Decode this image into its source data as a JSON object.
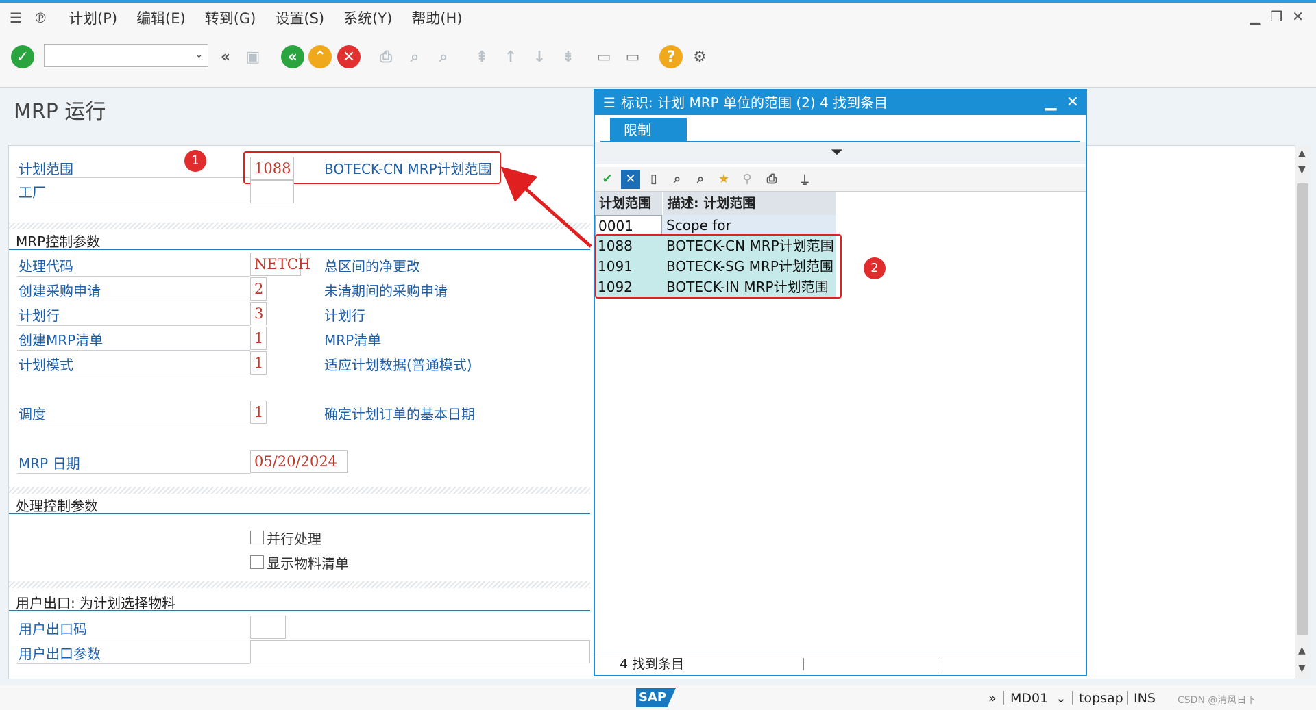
{
  "menubar": {
    "items": [
      "计划(P)",
      "编辑(E)",
      "转到(G)",
      "设置(S)",
      "系统(Y)",
      "帮助(H)"
    ]
  },
  "page": {
    "title": "MRP 运行"
  },
  "form": {
    "planning_scope": {
      "label": "计划范围",
      "value": "1088",
      "desc": "BOTECK-CN MRP计划范围"
    },
    "plant": {
      "label": "工厂",
      "value": ""
    },
    "mrp_control": {
      "title": "MRP控制参数",
      "rows": [
        {
          "label": "处理代码",
          "value": "NETCH",
          "desc": "总区间的净更改"
        },
        {
          "label": "创建采购申请",
          "value": "2",
          "desc": "未清期间的采购申请"
        },
        {
          "label": "计划行",
          "value": "3",
          "desc": "计划行"
        },
        {
          "label": "创建MRP清单",
          "value": "1",
          "desc": "MRP清单"
        },
        {
          "label": "计划模式",
          "value": "1",
          "desc": "适应计划数据(普通模式)"
        },
        {
          "label": "调度",
          "value": "1",
          "desc": "确定计划订单的基本日期"
        },
        {
          "label": "MRP 日期",
          "value": "05/20/2024",
          "desc": ""
        }
      ]
    },
    "process_control": {
      "title": "处理控制参数",
      "options": [
        "并行处理",
        "显示物料清单"
      ]
    },
    "user_exit": {
      "title": "用户出口: 为计划选择物料",
      "key_label": "用户出口码",
      "param_label": "用户出口参数"
    }
  },
  "markers": [
    "1",
    "2"
  ],
  "popup": {
    "title": "标识: 计划 MRP 单位的范围 (2)    4 找到条目",
    "tab": "限制",
    "columns": [
      "计划范围",
      "描述: 计划范围"
    ],
    "rows": [
      {
        "code": "0001",
        "desc": "Scope for Subcontracting"
      },
      {
        "code": "1088",
        "desc": "BOTECK-CN MRP计划范围"
      },
      {
        "code": "1091",
        "desc": "BOTECK-SG MRP计划范围"
      },
      {
        "code": "1092",
        "desc": "BOTECK-IN MRP计划范围"
      }
    ],
    "status": "4 找到条目"
  },
  "statusbar": {
    "logo": "SAP",
    "arrows": "»",
    "tcode": "MD01",
    "system": "topsap",
    "mode": "INS",
    "watermark": "CSDN @清风日下"
  },
  "colors": {
    "accent": "#1b8fd6",
    "label_blue": "#1e5fa8",
    "value_red": "#c0392b",
    "highlight": "#e02020"
  }
}
